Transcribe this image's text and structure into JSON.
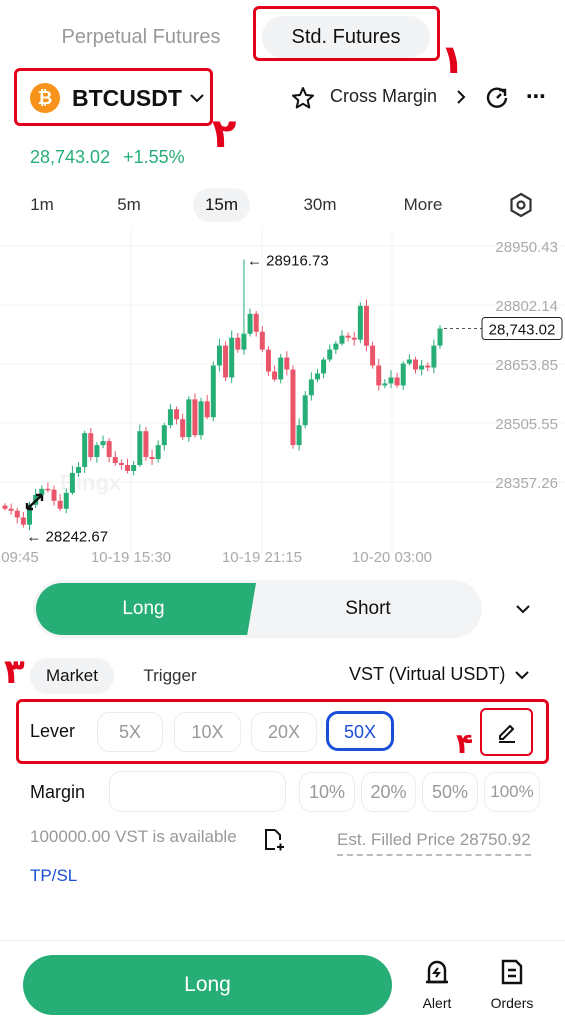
{
  "tabs": [
    {
      "label": "Perpetual Futures",
      "active": false
    },
    {
      "label": "Std. Futures",
      "active": true
    }
  ],
  "annotations": {
    "n1": "۱",
    "n2": "۲",
    "n3": "۳",
    "n4": "۴",
    "color": "#e3001b"
  },
  "symbol": {
    "name": "BTCUSDT",
    "icon": "bitcoin-icon",
    "price": "28,743.02",
    "change": "+1.55%"
  },
  "header": {
    "margin_mode": "Cross Margin"
  },
  "intervals": [
    {
      "label": "1m"
    },
    {
      "label": "5m"
    },
    {
      "label": "15m",
      "active": true
    },
    {
      "label": "30m"
    },
    {
      "label": "More"
    }
  ],
  "chart": {
    "y_ticks": [
      "28950.43",
      "28802.14",
      "28653.85",
      "28505.55",
      "28357.26"
    ],
    "y_values": [
      28950.43,
      28802.14,
      28653.85,
      28505.55,
      28357.26
    ],
    "x_ticks": [
      "09:45",
      "10-19 15:30",
      "10-19 21:15",
      "10-20 03:00"
    ],
    "high_label": "28916.73",
    "low_label": "28242.67",
    "last_price": "28,743.02",
    "watermark": "Bingx",
    "closes": [
      28290,
      28285,
      28268,
      28250,
      28300,
      28325,
      28340,
      28338,
      28310,
      28290,
      28330,
      28380,
      28395,
      28480,
      28420,
      28450,
      28460,
      28420,
      28405,
      28400,
      28385,
      28400,
      28485,
      28420,
      28415,
      28450,
      28500,
      28540,
      28515,
      28470,
      28565,
      28475,
      28560,
      28520,
      28650,
      28700,
      28620,
      28720,
      28690,
      28730,
      28780,
      28735,
      28690,
      28635,
      28615,
      28670,
      28640,
      28450,
      28500,
      28575,
      28615,
      28630,
      28665,
      28690,
      28705,
      28725,
      28720,
      28715,
      28800,
      28700,
      28650,
      28600,
      28605,
      28620,
      28600,
      28655,
      28665,
      28640,
      28650,
      28645,
      28700,
      28743
    ],
    "colors": {
      "up": "#27ae77",
      "down": "#e9566a"
    }
  },
  "order": {
    "side_long": "Long",
    "side_short": "Short",
    "types": [
      {
        "label": "Market",
        "active": true
      },
      {
        "label": "Trigger"
      }
    ],
    "currency": "VST (Virtual USDT)",
    "lever_label": "Lever",
    "levers": [
      {
        "label": "5X"
      },
      {
        "label": "10X"
      },
      {
        "label": "20X"
      },
      {
        "label": "50X",
        "active": true
      }
    ],
    "margin_label": "Margin",
    "margin_value": "",
    "percents": [
      "10%",
      "20%",
      "50%",
      "100%"
    ],
    "available": "100000.00 VST is available",
    "est_price": "Est. Filled Price 28750.92",
    "tpsl": "TP/SL"
  },
  "bottom": {
    "long_button": "Long",
    "alert": "Alert",
    "orders": "Orders"
  },
  "colors": {
    "green": "#27ae77",
    "blue": "#1a4fd6"
  }
}
